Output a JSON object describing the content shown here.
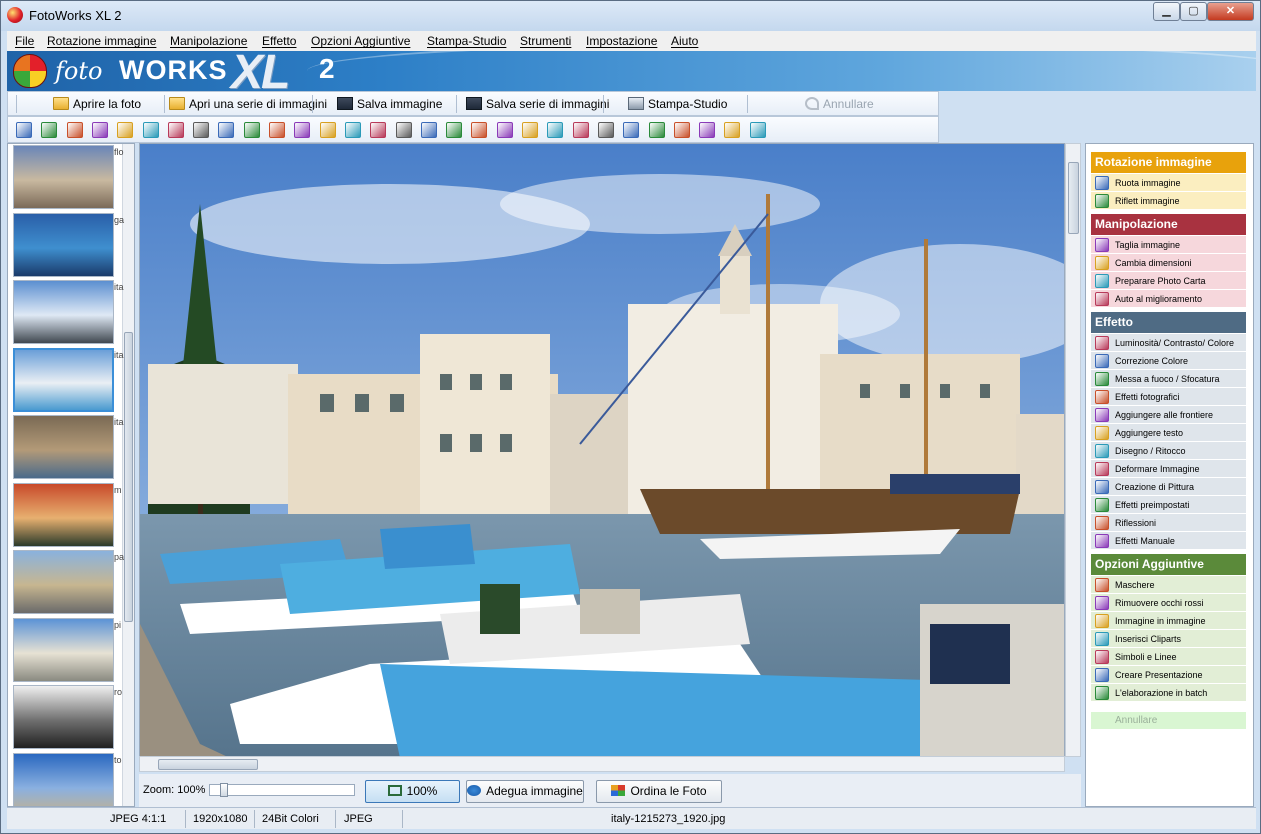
{
  "window": {
    "title": "FotoWorks XL 2",
    "min": "▁",
    "max": "▢",
    "close": "✕"
  },
  "menu": [
    "File",
    "Rotazione immagine",
    "Manipolazione",
    "Effetto",
    "Opzioni Aggiuntive",
    "Stampa-Studio",
    "Strumenti",
    "Impostazione",
    "Aiuto"
  ],
  "banner": {
    "logo_foto": "foto",
    "logo_works": "WORKS",
    "logo_xl": "XL",
    "logo_num": "2"
  },
  "toolbar": {
    "open": "Aprire la foto",
    "open_series": "Apri una serie di immagini",
    "save": "Salva immagine",
    "save_series": "Salva serie di immagini",
    "print_studio": "Stampa-Studio",
    "undo": "Annullare"
  },
  "toolbar2_icons": [
    "rotate-left-icon",
    "rotate-right-icon",
    "rotate-ccw-icon",
    "rotate-cw-icon",
    "flip-icon",
    "mirror-icon",
    "straighten-icon",
    "cut-icon",
    "crop-icon",
    "resize-icon",
    "auto-fix-icon",
    "levels-icon",
    "color-icon",
    "focus-icon",
    "camera-effect-icon",
    "frame-icon",
    "text-icon",
    "draw-icon",
    "deform-icon",
    "paint-icon",
    "preset-icon",
    "reflection-icon",
    "manual-effect-icon",
    "mask-icon",
    "red-eye-icon",
    "picture-in-picture-icon",
    "clipart-icon",
    "shapes-icon",
    "presentation-icon",
    "batch-icon"
  ],
  "thumbnails": [
    {
      "label": "flo",
      "colors": [
        "#6a86b8",
        "#c9b9a0",
        "#7b6a58"
      ]
    },
    {
      "label": "ga",
      "colors": [
        "#2a5fa8",
        "#3f8fcf",
        "#1a3a6a"
      ]
    },
    {
      "label": "ita",
      "colors": [
        "#5b8fd0",
        "#dfe9f5",
        "#404850"
      ]
    },
    {
      "label": "ita",
      "colors": [
        "#6a9fd8",
        "#eaeff4",
        "#4a9ad0"
      ]
    },
    {
      "label": "ita",
      "colors": [
        "#7a6a54",
        "#b39a78",
        "#4a6a8a"
      ]
    },
    {
      "label": "m",
      "colors": [
        "#c84a2a",
        "#e7b070",
        "#2a3a2a"
      ]
    },
    {
      "label": "pa",
      "colors": [
        "#8ab2dd",
        "#c7b690",
        "#6a6a6a"
      ]
    },
    {
      "label": "pi",
      "colors": [
        "#5b93d6",
        "#e7e2d4",
        "#8a8a80"
      ]
    },
    {
      "label": "ro",
      "colors": [
        "#f0f0f0",
        "#707070",
        "#202020"
      ]
    },
    {
      "label": "to",
      "colors": [
        "#2a68c0",
        "#8ab0e0",
        "#c7b28a"
      ]
    }
  ],
  "zoom": {
    "label": "Zoom: 100%",
    "value_pct": 100,
    "btn_100": "100%",
    "btn_fit": "Adegua immagine",
    "btn_sort": "Ordina le Foto"
  },
  "sidebar": {
    "sections": [
      {
        "title": "Rotazione immagine",
        "color": "#e8a20c",
        "item_bg": "#fbeec0",
        "items": [
          {
            "label": "Ruota immagine",
            "icon": "rotate-image-icon"
          },
          {
            "label": "Riflett immagine",
            "icon": "mirror-image-icon"
          }
        ]
      },
      {
        "title": "Manipolazione",
        "color": "#a83240",
        "item_bg": "#f6d7dc",
        "items": [
          {
            "label": "Taglia immagine",
            "icon": "scissors-icon"
          },
          {
            "label": "Cambia dimensioni",
            "icon": "resize-icon"
          },
          {
            "label": "Preparare Photo Carta",
            "icon": "photo-paper-icon"
          },
          {
            "label": "Auto al miglioramento",
            "icon": "magic-wand-icon"
          }
        ]
      },
      {
        "title": "Effetto",
        "color": "#4f6b84",
        "item_bg": "#dfe5eb",
        "items": [
          {
            "label": "Luminosità/ Contrasto/ Colore",
            "icon": "brightness-icon"
          },
          {
            "label": "Correzione Colore",
            "icon": "color-correction-icon"
          },
          {
            "label": "Messa a fuoco / Sfocatura",
            "icon": "focus-blur-icon"
          },
          {
            "label": "Effetti fotografici",
            "icon": "camera-icon"
          },
          {
            "label": "Aggiungere alle frontiere",
            "icon": "border-icon"
          },
          {
            "label": "Aggiungere testo",
            "icon": "text-icon"
          },
          {
            "label": "Disegno / Ritocco",
            "icon": "draw-icon"
          },
          {
            "label": "Deformare Immagine",
            "icon": "deform-icon"
          },
          {
            "label": "Creazione di Pittura",
            "icon": "paint-icon"
          },
          {
            "label": "Effetti preimpostati",
            "icon": "preset-icon"
          },
          {
            "label": "Riflessioni",
            "icon": "reflection-icon"
          },
          {
            "label": "Effetti Manuale",
            "icon": "manual-effect-icon"
          }
        ]
      },
      {
        "title": "Opzioni Aggiuntive",
        "color": "#5b8a3a",
        "item_bg": "#e2eed6",
        "items": [
          {
            "label": "Maschere",
            "icon": "mask-icon"
          },
          {
            "label": "Rimuovere occhi rossi",
            "icon": "red-eye-icon"
          },
          {
            "label": "Immagine in immagine",
            "icon": "picture-in-picture-icon"
          },
          {
            "label": "Inserisci Cliparts",
            "icon": "clipart-icon"
          },
          {
            "label": "Simboli e Linee",
            "icon": "symbols-icon"
          },
          {
            "label": "Creare Presentazione",
            "icon": "star-icon"
          },
          {
            "label": "L'elaborazione in batch",
            "icon": "batch-icon"
          }
        ]
      }
    ],
    "undo": "Annullare"
  },
  "status": {
    "format": "JPEG  4:1:1",
    "size": "1920x1080",
    "depth": "24Bit Colori",
    "type": "JPEG",
    "file": "italy-1215273_1920.jpg"
  }
}
